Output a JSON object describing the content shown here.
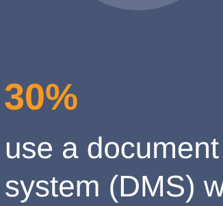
{
  "colors": {
    "background": "#475674",
    "circle": "#66728d",
    "accent": "#f49a22",
    "text": "#ffffff"
  },
  "stat": {
    "value": "30%",
    "line1": "use a document",
    "line2": "system (DMS) w"
  }
}
